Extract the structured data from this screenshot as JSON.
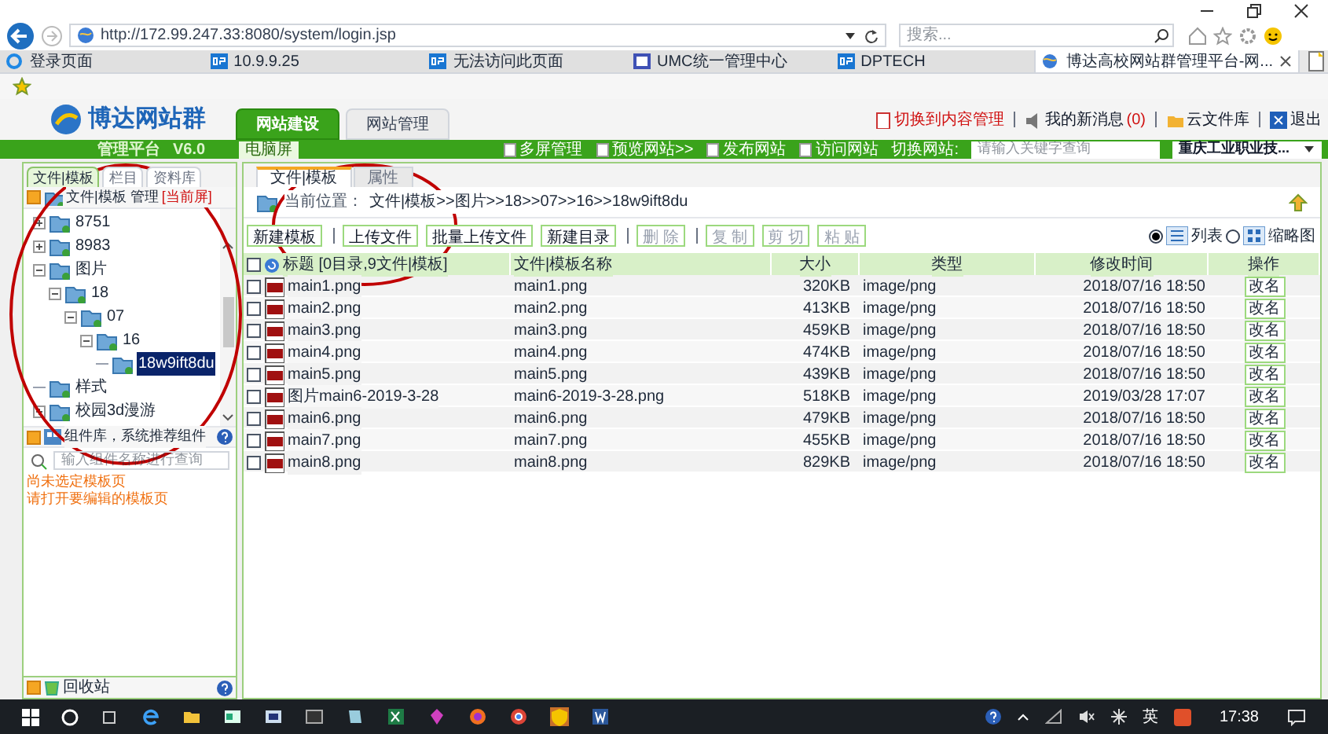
{
  "address_bar": {
    "url": "http://172.99.247.33:8080/system/login.jsp"
  },
  "search": {
    "placeholder": "搜索..."
  },
  "browser_tabs": [
    {
      "label": "登录页面",
      "selected": false,
      "kind": "ie"
    },
    {
      "label": "10.9.9.25",
      "selected": false,
      "kind": "dp"
    },
    {
      "label": "无法访问此页面",
      "selected": false,
      "kind": "dp"
    },
    {
      "label": "UMC统一管理中心",
      "selected": false,
      "kind": "umc"
    },
    {
      "label": "DPTECH",
      "selected": false,
      "kind": "dp"
    },
    {
      "label": "博达高校网站群管理平台-网...",
      "selected": true,
      "kind": "globe"
    }
  ],
  "app": {
    "logo": "博达网站群",
    "platform": "管理平台",
    "version": "V6.0",
    "main_tabs": [
      {
        "label": "网站建设",
        "selected": true
      },
      {
        "label": "网站管理",
        "selected": false
      }
    ],
    "top_links": [
      {
        "kind": "switch",
        "label": "切换到内容管理"
      },
      {
        "kind": "messages",
        "label": "我的新消息",
        "count": "(0)"
      },
      {
        "kind": "library",
        "label": "云文件库"
      },
      {
        "kind": "logout",
        "label": "退出"
      }
    ],
    "screen_label": "电脑屏",
    "toolbar": [
      "多屏管理",
      "预览网站>>",
      "发布网站",
      "访问网站"
    ],
    "site_switch": {
      "label": "切换网站:",
      "placeholder": "请输入关键字查询",
      "site": "重庆工业职业技..."
    }
  },
  "sidebar": {
    "tabs": [
      {
        "label": "文件|模板",
        "selected": true
      },
      {
        "label": "栏目",
        "selected": false
      },
      {
        "label": "资料库",
        "selected": false
      }
    ],
    "header": {
      "title": "文件|模板 管理",
      "screen": "[当前屏]"
    },
    "tree": [
      {
        "label": "8751",
        "expanded": false,
        "selected": false
      },
      {
        "label": "8983",
        "expanded": false,
        "selected": false
      },
      {
        "label": "图片",
        "expanded": true,
        "selected": false,
        "children": [
          {
            "label": "18",
            "expanded": true,
            "selected": false,
            "children": [
              {
                "label": "07",
                "expanded": true,
                "selected": false,
                "children": [
                  {
                    "label": "16",
                    "expanded": true,
                    "selected": false,
                    "children": [
                      {
                        "label": "18w9ift8du",
                        "selected": true
                      }
                    ]
                  }
                ]
              }
            ]
          }
        ]
      },
      {
        "label": "样式",
        "selected": false
      },
      {
        "label": "校园3d漫游",
        "expanded": false,
        "selected": false
      }
    ],
    "components": {
      "title": "组件库，系统推荐组件",
      "placeholder": "输入组件名称进行查询",
      "notes": [
        "尚未选定模板页",
        "请打开要编辑的模板页"
      ]
    },
    "recycle_bin": "回收站"
  },
  "main": {
    "tabs": [
      {
        "label": "文件|模板",
        "selected": true
      },
      {
        "label": "属性",
        "selected": false
      }
    ],
    "location_label": "当前位置：",
    "path": "文件|模板>>图片>>18>>07>>16>>18w9ift8du",
    "action_groups": [
      [
        {
          "label": "新建模板",
          "disabled": false
        }
      ],
      [
        {
          "label": "上传文件",
          "disabled": false
        },
        {
          "label": "批量上传文件",
          "disabled": false
        },
        {
          "label": "新建目录",
          "disabled": false
        }
      ],
      [
        {
          "label": "删 除",
          "disabled": true
        }
      ],
      [
        {
          "label": "复 制",
          "disabled": true
        },
        {
          "label": "剪 切",
          "disabled": true
        },
        {
          "label": "粘 贴",
          "disabled": true
        }
      ]
    ],
    "view_modes": [
      {
        "label": "列表",
        "selected": true
      },
      {
        "label": "缩略图",
        "selected": false
      }
    ],
    "table": {
      "all_checked": false,
      "columns": [
        "标题 [0目录,9文件|模板]",
        "文件|模板名称",
        "大小",
        "类型",
        "修改时间",
        "操作"
      ],
      "rows": [
        {
          "title": "main1.png",
          "name": "main1.png",
          "size": "320KB",
          "type": "image/png",
          "modified": "2018/07/16 18:50",
          "action": "改名",
          "checked": false
        },
        {
          "title": "main2.png",
          "name": "main2.png",
          "size": "413KB",
          "type": "image/png",
          "modified": "2018/07/16 18:50",
          "action": "改名",
          "checked": false
        },
        {
          "title": "main3.png",
          "name": "main3.png",
          "size": "459KB",
          "type": "image/png",
          "modified": "2018/07/16 18:50",
          "action": "改名",
          "checked": false
        },
        {
          "title": "main4.png",
          "name": "main4.png",
          "size": "474KB",
          "type": "image/png",
          "modified": "2018/07/16 18:50",
          "action": "改名",
          "checked": false
        },
        {
          "title": "main5.png",
          "name": "main5.png",
          "size": "439KB",
          "type": "image/png",
          "modified": "2018/07/16 18:50",
          "action": "改名",
          "checked": false
        },
        {
          "title": "图片main6-2019-3-28",
          "name": "main6-2019-3-28.png",
          "size": "518KB",
          "type": "image/png",
          "modified": "2019/03/28 17:07",
          "action": "改名",
          "checked": false
        },
        {
          "title": "main6.png",
          "name": "main6.png",
          "size": "479KB",
          "type": "image/png",
          "modified": "2018/07/16 18:50",
          "action": "改名",
          "checked": false
        },
        {
          "title": "main7.png",
          "name": "main7.png",
          "size": "455KB",
          "type": "image/png",
          "modified": "2018/07/16 18:50",
          "action": "改名",
          "checked": false
        },
        {
          "title": "main8.png",
          "name": "main8.png",
          "size": "829KB",
          "type": "image/png",
          "modified": "2018/07/16 18:50",
          "action": "改名",
          "checked": false
        }
      ]
    }
  },
  "taskbar": {
    "ime": "英",
    "time": "17:38"
  }
}
